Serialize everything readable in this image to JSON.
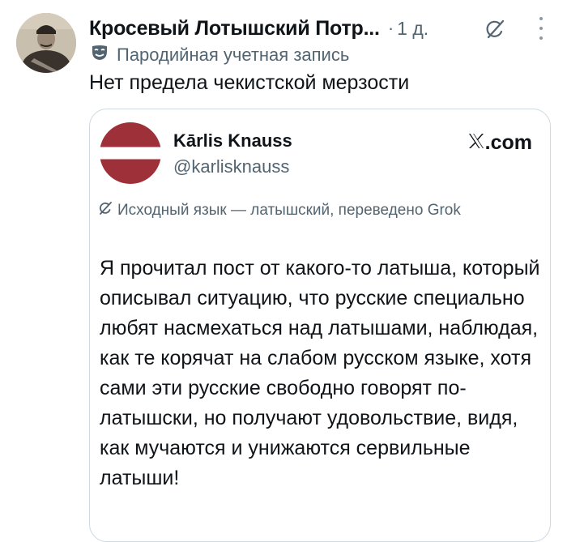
{
  "post": {
    "author_name": "Кросевый Лотышский Потр...",
    "time_separator": "·",
    "time": "1 д.",
    "parody_label": "Пародийная учетная запись",
    "text": "Нет предела чекистской мерзости"
  },
  "icons": {
    "grok": "grok-icon",
    "more": "more-options-icon",
    "parody": "theater-mask-icon",
    "x_logo": "x-logo-icon"
  },
  "quote": {
    "name": "Kārlis Knauss",
    "handle": "@karlisknauss",
    "source": ".com",
    "translation_note": "Исходный язык — латышский, переведено Grok",
    "body": "Я прочитал пост от какого-то латыша, который описывал ситуацию, что русские специально любят насмехаться над латышами, наблюдая, как те корячат на слабом русском языке, хотя сами эти русские свободно говорят по-латышски, но получают удовольствие, видя, как мучаются и унижаются сервильные латыши!"
  },
  "colors": {
    "text": "#0f1419",
    "secondary": "#536471",
    "border": "#cfd9de",
    "flag_red": "#9e3039"
  }
}
